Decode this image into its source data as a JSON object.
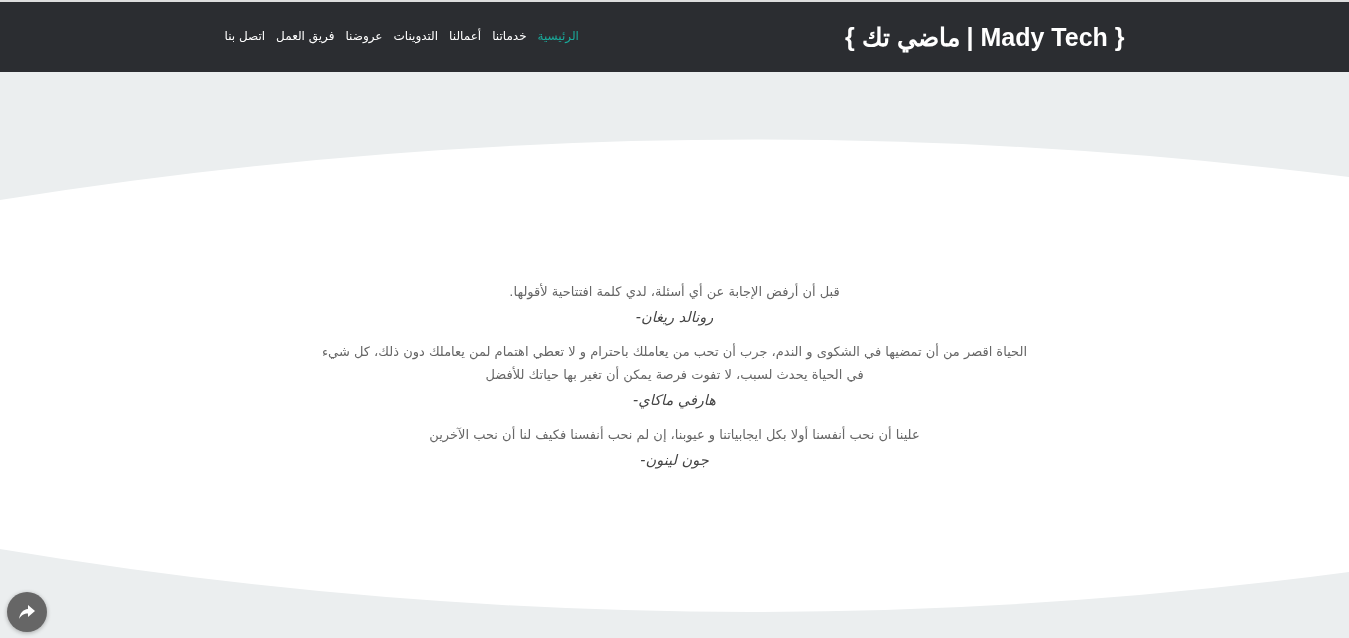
{
  "header": {
    "logo": "{ ماضي تك | Mady Tech }",
    "nav": [
      {
        "label": "الرئيسية",
        "selected": true
      },
      {
        "label": "خدماتنا",
        "selected": false
      },
      {
        "label": "أعمالنا",
        "selected": false
      },
      {
        "label": "التدوينات",
        "selected": false
      },
      {
        "label": "عروضنا",
        "selected": false
      },
      {
        "label": "فريق العمل",
        "selected": false
      },
      {
        "label": "اتصل بنا",
        "selected": false
      }
    ]
  },
  "quotes": [
    {
      "text": "قبل أن أرفض الإجابة عن أي أسئلة، لدي كلمة افتتاحية لأقولها.",
      "author": "رونالد ريغان-"
    },
    {
      "text": "الحياة اقصر من أن تمضيها في الشكوى و الندم، جرب أن تحب من يعاملك باحترام و لا تعطي اهتمام لمن يعاملك دون ذلك، كل شيء في الحياة يحدث لسبب، لا تفوت فرصة يمكن أن تغير بها حياتك للأفضل",
      "author": "هارفي ماكاي-"
    },
    {
      "text": "علينا أن نحب أنفسنا أولا بكل ايجابياتنا و عيوبنا، إن لم نحب أنفسنا فكيف لنا أن نحب الآخرين",
      "author": "جون لينون-"
    }
  ]
}
